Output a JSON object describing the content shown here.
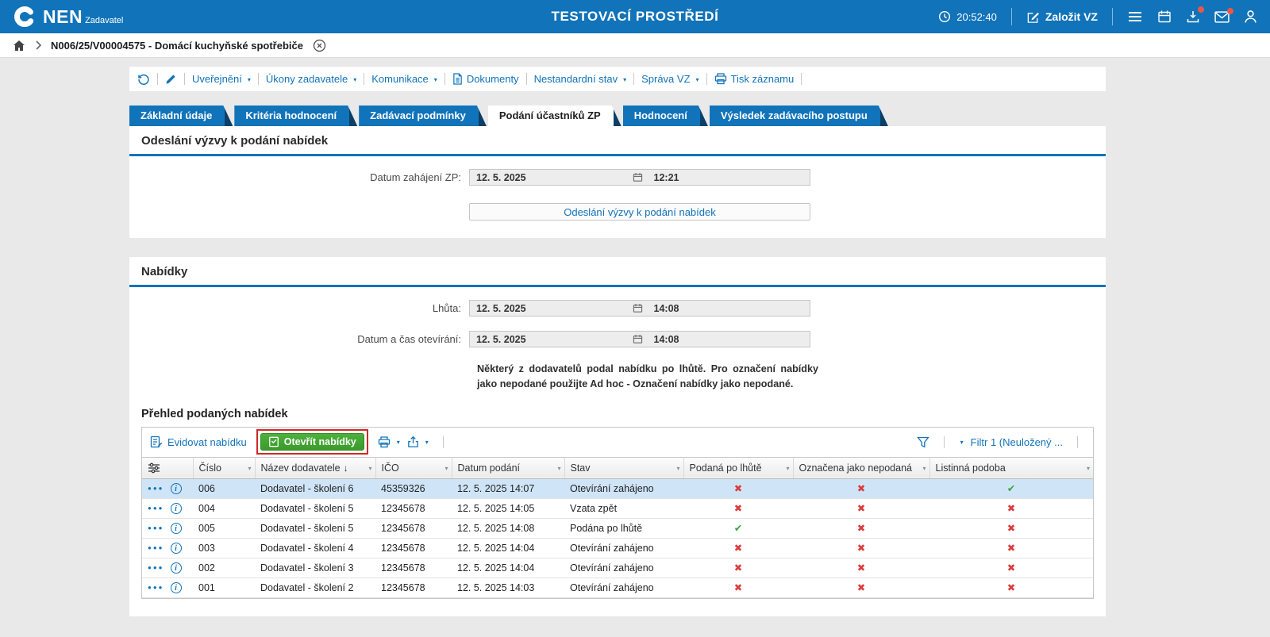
{
  "colors": {
    "accent_blue": "#1173b9",
    "green_button": "#3ea231",
    "check_green": "#3aa53a",
    "cross_red": "#dc3c3c",
    "selected_row": "#cfe5f7",
    "annotation_red": "#cf2a27"
  },
  "icons": {
    "caret_down": "▾",
    "sort_desc": "↓",
    "check": "✔",
    "cross": "✖",
    "dots_menu": "●●●",
    "info": "i"
  },
  "topbar": {
    "brand": "NEN",
    "brand_sub": "Zadavatel",
    "env_title": "TESTOVACÍ PROSTŘEDÍ",
    "clock": "20:52:40",
    "create_vz_label": "Založit VZ"
  },
  "breadcrumb": {
    "record": "N006/25/V00004575 - Domácí kuchyňské spotřebiče"
  },
  "toolbar": {
    "items": [
      {
        "label": "Uveřejnění"
      },
      {
        "label": "Úkony zadavatele"
      },
      {
        "label": "Komunikace"
      },
      {
        "label": "Dokumenty"
      },
      {
        "label": "Nestandardní stav"
      },
      {
        "label": "Správa VZ"
      },
      {
        "label": "Tisk záznamu"
      }
    ]
  },
  "tabs": [
    {
      "label": "Základní údaje",
      "active": false
    },
    {
      "label": "Kritéria hodnocení",
      "active": false
    },
    {
      "label": "Zadávací podmínky",
      "active": false
    },
    {
      "label": "Podání účastníků ZP",
      "active": true
    },
    {
      "label": "Hodnocení",
      "active": false
    },
    {
      "label": "Výsledek zadávacího postupu",
      "active": false
    }
  ],
  "invitation": {
    "title": "Odeslání výzvy k podání nabídek",
    "date_label": "Datum zahájení ZP:",
    "date_value": "12. 5. 2025",
    "time_value": "12:21",
    "send_button": "Odeslání výzvy k podání nabídek"
  },
  "offers_section": {
    "title": "Nabídky",
    "deadline_label": "Lhůta:",
    "deadline_date": "12. 5. 2025",
    "deadline_time": "14:08",
    "opening_label": "Datum a čas otevírání:",
    "opening_date": "12. 5. 2025",
    "opening_time": "14:08",
    "warning": "Některý z dodavatelů podal nabídku po lhůtě. Pro označení nabídky jako nepodané použijte Ad hoc - Označení nabídky jako nepodané."
  },
  "grid": {
    "title": "Přehled podaných nabídek",
    "record_offer_label": "Evidovat nabídku",
    "open_offers_label": "Otevřít nabídky",
    "filter_label": "Filtr 1 (Neuložený ...",
    "columns": [
      "Číslo",
      "Název dodavatele",
      "IČO",
      "Datum podání",
      "Stav",
      "Podaná po lhůtě",
      "Označena jako nepodaná",
      "Listinná podoba"
    ],
    "rows": [
      {
        "cislo": "006",
        "dodavatel": "Dodavatel - školení 6",
        "ico": "45359326",
        "datum": "12. 5. 2025 14:07",
        "stav": "Otevírání zahájeno",
        "podana_po_lhute": false,
        "oznacena_nepodana": false,
        "listinna_podoba": true,
        "selected": true
      },
      {
        "cislo": "004",
        "dodavatel": "Dodavatel - školení 5",
        "ico": "12345678",
        "datum": "12. 5. 2025 14:05",
        "stav": "Vzata zpět",
        "podana_po_lhute": false,
        "oznacena_nepodana": false,
        "listinna_podoba": false,
        "selected": false
      },
      {
        "cislo": "005",
        "dodavatel": "Dodavatel - školení 5",
        "ico": "12345678",
        "datum": "12. 5. 2025 14:08",
        "stav": "Podána po lhůtě",
        "podana_po_lhute": true,
        "oznacena_nepodana": false,
        "listinna_podoba": false,
        "selected": false
      },
      {
        "cislo": "003",
        "dodavatel": "Dodavatel - školení 4",
        "ico": "12345678",
        "datum": "12. 5. 2025 14:04",
        "stav": "Otevírání zahájeno",
        "podana_po_lhute": false,
        "oznacena_nepodana": false,
        "listinna_podoba": false,
        "selected": false
      },
      {
        "cislo": "002",
        "dodavatel": "Dodavatel - školení 3",
        "ico": "12345678",
        "datum": "12. 5. 2025 14:04",
        "stav": "Otevírání zahájeno",
        "podana_po_lhute": false,
        "oznacena_nepodana": false,
        "listinna_podoba": false,
        "selected": false
      },
      {
        "cislo": "001",
        "dodavatel": "Dodavatel - školení 2",
        "ico": "12345678",
        "datum": "12. 5. 2025 14:03",
        "stav": "Otevírání zahájeno",
        "podana_po_lhute": false,
        "oznacena_nepodana": false,
        "listinna_podoba": false,
        "selected": false
      }
    ]
  }
}
